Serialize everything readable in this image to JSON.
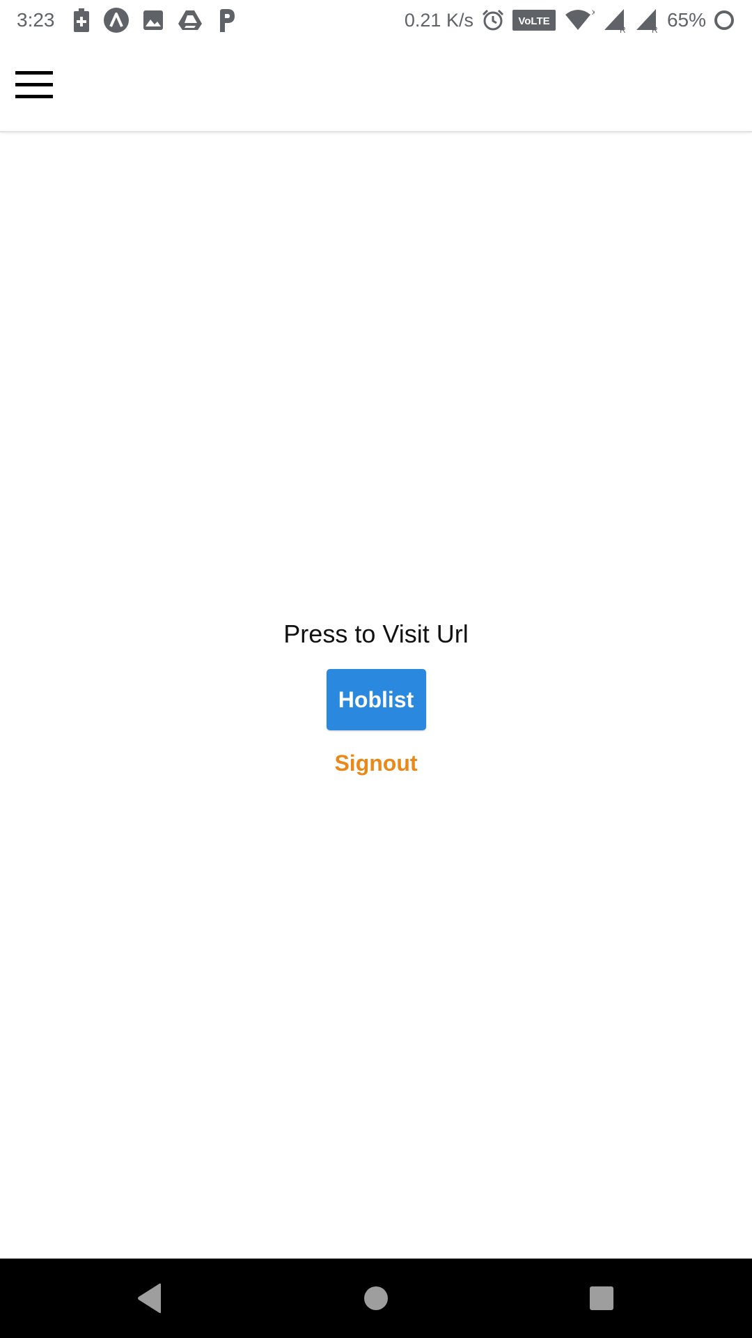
{
  "status_bar": {
    "time": "3:23",
    "network_speed": "0.21 K/s",
    "volte_label": "VoLTE",
    "battery_percent": "65%",
    "left_icons": [
      "battery-saver-icon",
      "app-a-icon",
      "gallery-icon",
      "drive-icon",
      "parking-app-icon"
    ],
    "right_icons": [
      "alarm-icon",
      "volte-icon",
      "wifi-icon",
      "signal-r-icon",
      "signal-r-icon",
      "battery-ring-icon"
    ],
    "icon_color": "#5f6368"
  },
  "app_bar": {
    "menu_icon": "hamburger-menu-icon"
  },
  "main": {
    "prompt": "Press to Visit Url",
    "primary_button_label": "Hoblist",
    "signout_label": "Signout"
  },
  "nav_bar": {
    "buttons": [
      "back-icon",
      "home-icon",
      "recents-icon"
    ],
    "icon_color": "#9e9e9e"
  },
  "colors": {
    "primary_button": "#2a88de",
    "signout_text": "#e8891a",
    "nav_background": "#000000"
  }
}
